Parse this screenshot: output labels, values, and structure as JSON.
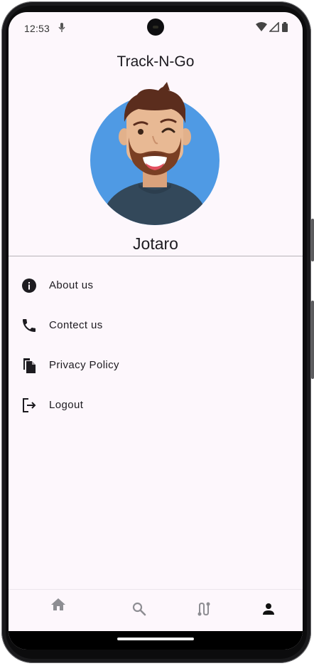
{
  "status_bar": {
    "time": "12:53",
    "icons": [
      "mic-icon",
      "wifi-icon",
      "signal-icon",
      "battery-icon"
    ]
  },
  "app": {
    "title": "Track-N-Go"
  },
  "profile": {
    "name": "Jotaro",
    "avatar": "avatar-winking-bearded-man"
  },
  "menu": [
    {
      "label": "About us",
      "icon": "info-icon"
    },
    {
      "label": "Contect us",
      "icon": "phone-icon"
    },
    {
      "label": "Privacy Policy",
      "icon": "document-icon"
    },
    {
      "label": "Logout",
      "icon": "logout-icon"
    }
  ],
  "bottom_nav": [
    {
      "name": "home",
      "icon": "home-icon",
      "active": false
    },
    {
      "name": "search",
      "icon": "search-icon",
      "active": false
    },
    {
      "name": "route",
      "icon": "route-icon",
      "active": false
    },
    {
      "name": "profile",
      "icon": "person-icon",
      "active": true
    }
  ],
  "colors": {
    "background": "#fdf7fc",
    "text": "#1d1b20",
    "nav_inactive": "#8e8e93",
    "nav_active": "#111111",
    "avatar_circle": "#4f9ae4"
  }
}
